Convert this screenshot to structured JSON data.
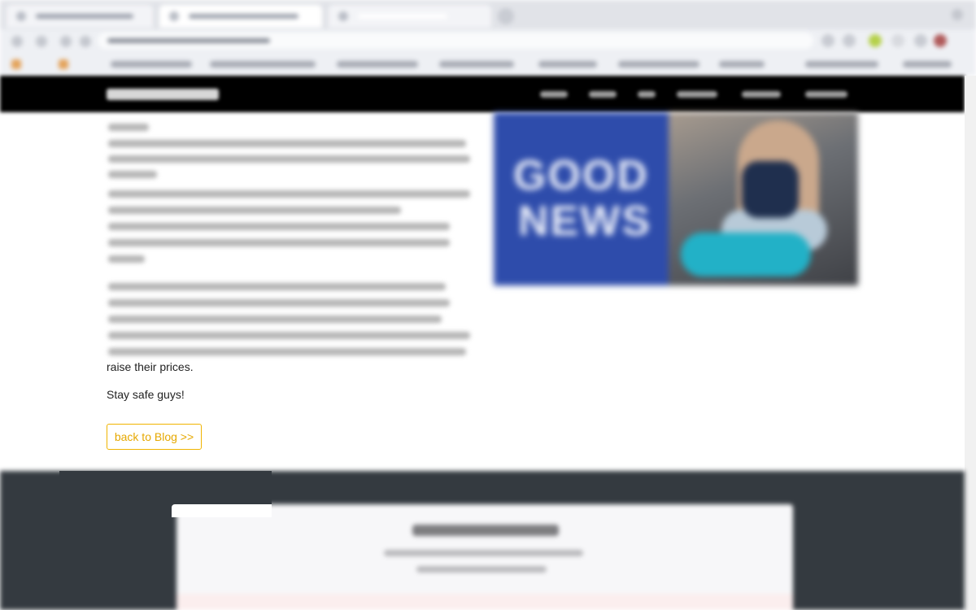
{
  "browser": {
    "tabs": [
      {
        "state": "inactive"
      },
      {
        "state": "active"
      },
      {
        "state": "inactive"
      }
    ],
    "bookmarks_count": 9
  },
  "site": {
    "nav_links_count": 6
  },
  "hero_image": {
    "text_line_1": "GOOD",
    "text_line_2": "NEWS",
    "colors": {
      "panel": "#2e4cab",
      "mat": "#22b1c7"
    }
  },
  "article": {
    "tail_text": "raise their prices.",
    "closing_text": "Stay safe guys!",
    "back_button_label": "back to Blog >>"
  },
  "colors": {
    "nav_background": "#000000",
    "accent": "#f0b400",
    "footer_background": "#343a40"
  }
}
